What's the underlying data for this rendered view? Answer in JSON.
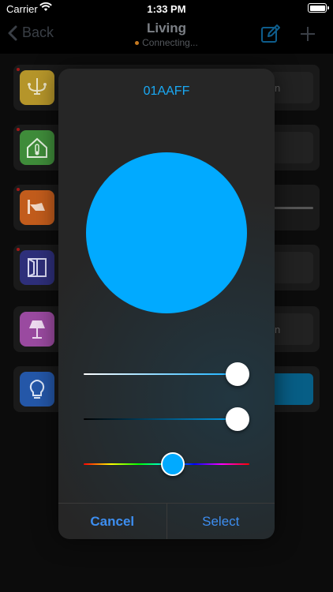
{
  "status_bar": {
    "carrier": "Carrier",
    "time": "1:33 PM"
  },
  "nav": {
    "back_label": "Back",
    "title": "Living",
    "subtitle": "Connecting..."
  },
  "devices": [
    {
      "icon": "chandelier-icon",
      "color": "#b5952a",
      "control_text": "n"
    },
    {
      "icon": "thermometer-house-icon",
      "color": "#3f8c3a",
      "control_text": ""
    },
    {
      "icon": "wall-lamp-icon",
      "color": "#c25c1c",
      "control_text": ""
    },
    {
      "icon": "window-icon",
      "color": "#2e2f7a",
      "control_text": ""
    },
    {
      "icon": "table-lamp-icon",
      "color": "#9a4aa0",
      "control_text": "n"
    },
    {
      "icon": "light-bulb-icon",
      "color": "#2457a8",
      "control_text": ""
    }
  ],
  "dialog": {
    "hex": "01AAFF",
    "color": "#01aaff",
    "brightness": 0.93,
    "saturation": 0.93,
    "hue": 0.54,
    "cancel_label": "Cancel",
    "select_label": "Select"
  }
}
